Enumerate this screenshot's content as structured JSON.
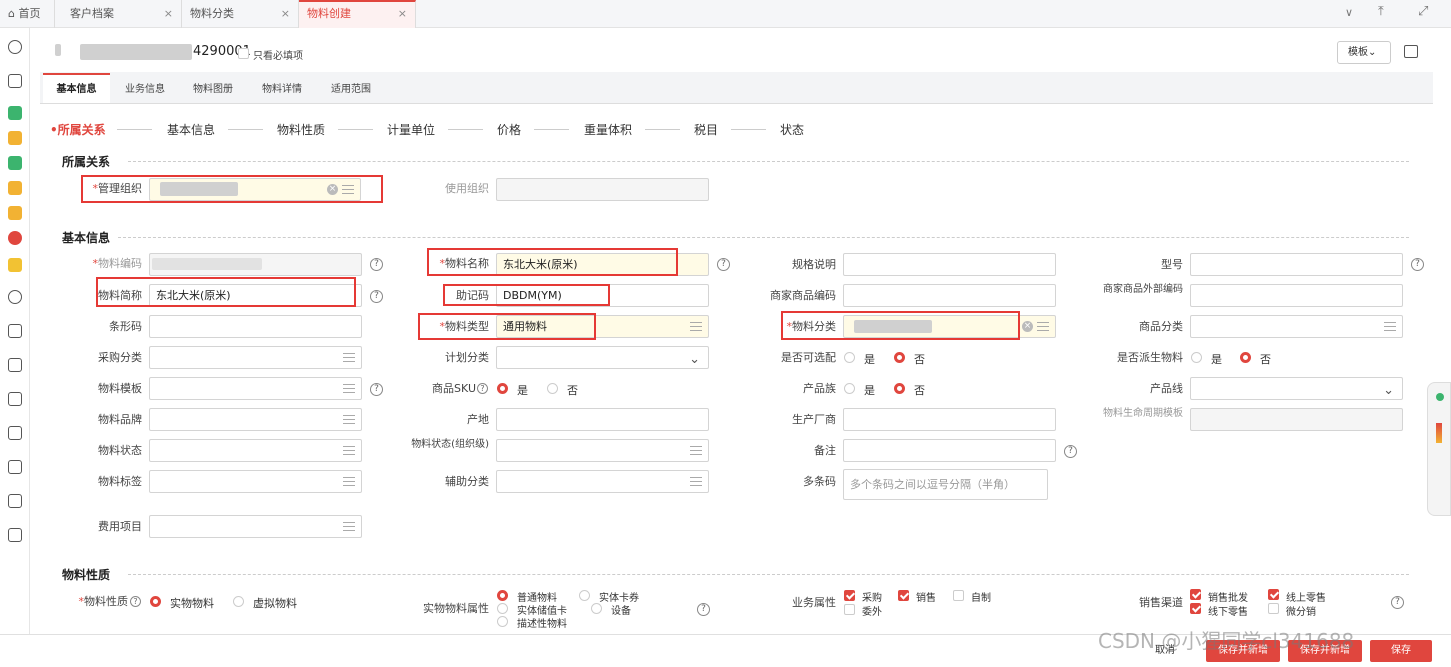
{
  "tabs": [
    {
      "icon": "home-icon",
      "label": "首页",
      "closable": false
    },
    {
      "label": "客户档案",
      "closable": true
    },
    {
      "label": "物料分类",
      "closable": true
    },
    {
      "label": "物料创建",
      "closable": true,
      "active": true
    }
  ],
  "header": {
    "title_fragment": "4290001",
    "only_required_label": "只看必填项",
    "template_label": "模板"
  },
  "subtabs": [
    "基本信息",
    "业务信息",
    "物料图册",
    "物料详情",
    "适用范围"
  ],
  "steps": [
    "所属关系",
    "基本信息",
    "物料性质",
    "计量单位",
    "价格",
    "重量体积",
    "税目",
    "状态"
  ],
  "sections": {
    "affiliation": "所属关系",
    "basic": "基本信息",
    "nature": "物料性质"
  },
  "affiliation": {
    "manage_org_label": "管理组织",
    "use_org_label": "使用组织"
  },
  "fields": {
    "code": {
      "label": "物料编码"
    },
    "name": {
      "label": "物料名称",
      "value": "东北大米(原米)"
    },
    "spec": {
      "label": "规格说明"
    },
    "model": {
      "label": "型号"
    },
    "short_name": {
      "label": "物料简称",
      "value": "东北大米(原米)"
    },
    "mnemonic": {
      "label": "助记码",
      "value": "DBDM(YM)"
    },
    "merchant_code": {
      "label": "商家商品编码"
    },
    "merchant_ext_code": {
      "label": "商家商品外部编码"
    },
    "barcode": {
      "label": "条形码"
    },
    "material_type": {
      "label": "物料类型",
      "value": "通用物料"
    },
    "material_class": {
      "label": "物料分类"
    },
    "goods_class": {
      "label": "商品分类"
    },
    "purchase_class": {
      "label": "采购分类"
    },
    "plan_class": {
      "label": "计划分类"
    },
    "optional": {
      "label": "是否可选配",
      "yes": "是",
      "no": "否"
    },
    "derived": {
      "label": "是否派生物料",
      "yes": "是",
      "no": "否"
    },
    "template": {
      "label": "物料模板"
    },
    "sku": {
      "label": "商品SKU",
      "yes": "是",
      "no": "否"
    },
    "product_family": {
      "label": "产品族",
      "yes": "是",
      "no": "否"
    },
    "product_line": {
      "label": "产品线"
    },
    "brand": {
      "label": "物料品牌"
    },
    "origin": {
      "label": "产地"
    },
    "manufacturer": {
      "label": "生产厂商"
    },
    "lifecycle": {
      "label": "物料生命周期模板"
    },
    "status": {
      "label": "物料状态"
    },
    "org_status": {
      "label": "物料状态(组织级)"
    },
    "remark": {
      "label": "备注"
    },
    "tag": {
      "label": "物料标签"
    },
    "aux_class": {
      "label": "辅助分类"
    },
    "multi_barcode": {
      "label": "多条码",
      "placeholder": "多个条码之间以逗号分隔（半角）"
    },
    "expense": {
      "label": "费用项目"
    }
  },
  "nature": {
    "material_nature": {
      "label": "物料性质",
      "options": [
        "实物物料",
        "虚拟物料"
      ],
      "selected": "实物物料"
    },
    "physical_attr": {
      "label": "实物物料属性",
      "options": [
        "普通物料",
        "实体卡券",
        "实体储值卡",
        "设备",
        "描述性物料"
      ],
      "selected": "普通物料"
    },
    "business_attr": {
      "label": "业务属性",
      "options": [
        {
          "label": "采购",
          "checked": true
        },
        {
          "label": "销售",
          "checked": true
        },
        {
          "label": "自制",
          "checked": false
        },
        {
          "label": "委外",
          "checked": false
        }
      ]
    },
    "sales_channel": {
      "label": "销售渠道",
      "options": [
        {
          "label": "销售批发",
          "checked": true
        },
        {
          "label": "线上零售",
          "checked": true
        },
        {
          "label": "线下零售",
          "checked": true
        },
        {
          "label": "微分销",
          "checked": false
        }
      ]
    }
  },
  "footer": {
    "cancel": "取消",
    "save_new": "保存并新增",
    "save_submit": "保存并新增",
    "save": "保存"
  },
  "watermark": "CSDN @小猩同学cl341688",
  "colors": {
    "accent": "#e0463e",
    "required_bg": "#fffbe6",
    "highlight_box": "#e53935"
  }
}
